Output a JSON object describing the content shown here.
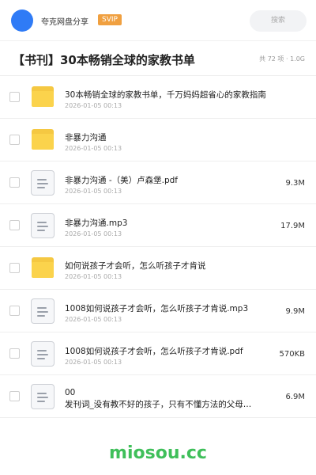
{
  "header": {
    "username": "夸克网盘分享",
    "badge": "SVIP",
    "search_placeholder": "搜索"
  },
  "title": {
    "text": "【书刊】30本畅销全球的家教书单",
    "meta": "共 72 项 · 1.0G"
  },
  "files": [
    {
      "type": "folder",
      "name": "30本畅销全球的家教书单，千万妈妈超省心的家教指南",
      "date": "2026-01-05 00:13",
      "size": ""
    },
    {
      "type": "folder",
      "name": "非暴力沟通",
      "date": "2026-01-05 00:13",
      "size": ""
    },
    {
      "type": "doc",
      "name": "非暴力沟通 -（美）卢森堡.pdf",
      "date": "2026-01-05 00:13",
      "size": "9.3M"
    },
    {
      "type": "doc",
      "name": "非暴力沟通.mp3",
      "date": "2026-01-05 00:13",
      "size": "17.9M"
    },
    {
      "type": "folder",
      "name": "如何说孩子才会听，怎么听孩子才肯说",
      "date": "2026-01-05 00:13",
      "size": ""
    },
    {
      "type": "doc",
      "name": "1008如何说孩子才会听，怎么听孩子才肯说.mp3",
      "date": "2026-01-05 00:13",
      "size": "9.9M"
    },
    {
      "type": "doc",
      "name": "1008如何说孩子才会听，怎么听孩子才肯说.pdf",
      "date": "2026-01-05 00:13",
      "size": "570KB"
    },
    {
      "type": "doc",
      "name": "00",
      "date": "2026-01-05 00:13",
      "size": "6.9M",
      "subtitle": "发刊词_没有教不好的孩子，只有不懂方法的父母…"
    }
  ],
  "watermark": "miosou.cc"
}
